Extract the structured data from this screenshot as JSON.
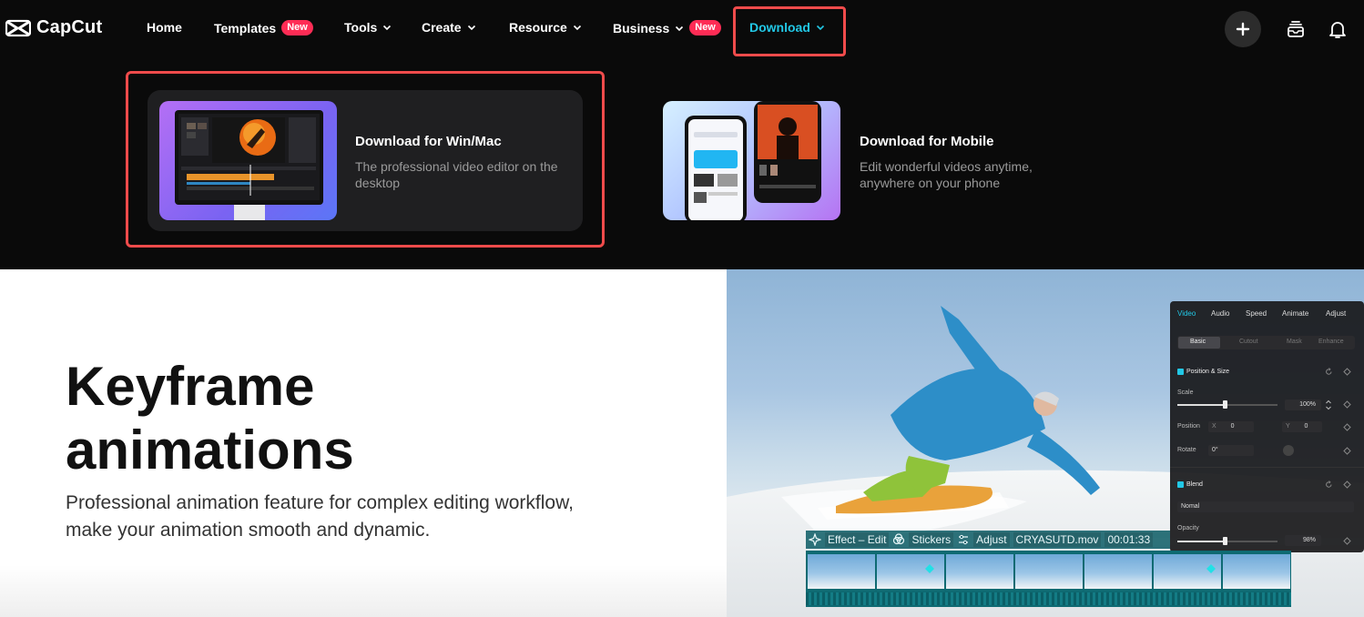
{
  "brand": {
    "name": "CapCut"
  },
  "nav": {
    "items": [
      {
        "label": "Home"
      },
      {
        "label": "Templates",
        "badge": "New"
      },
      {
        "label": "Tools"
      },
      {
        "label": "Create"
      },
      {
        "label": "Resource"
      },
      {
        "label": "Business",
        "badge": "New"
      },
      {
        "label": "Download",
        "active": true
      }
    ],
    "icons": [
      "plus-icon",
      "inbox-icon",
      "bell-icon"
    ],
    "accent_color": "#22c8e6",
    "badge_color": "#fe2c55",
    "highlight_color": "#f04b4b"
  },
  "dropdown": {
    "cards": [
      {
        "title": "Download for Win/Mac",
        "desc": "The professional video editor on the desktop"
      },
      {
        "title": "Download for Mobile",
        "desc": "Edit wonderful videos anytime, anywhere on your phone"
      }
    ]
  },
  "hero": {
    "title_line1": "Keyframe",
    "title_line2": "animations",
    "subtitle": "Professional animation feature for complex editing workflow, make your animation smooth and dynamic."
  },
  "editor_panel": {
    "tabs": [
      "Video",
      "Audio",
      "Speed",
      "Animate",
      "Adjust"
    ],
    "segments": [
      "Basic",
      "Cutout",
      "Mask",
      "Enhance"
    ],
    "position_size_label": "Position & Size",
    "scale_label": "Scale",
    "scale_value": "100%",
    "position_label": "Position",
    "pos_x_label": "X",
    "pos_x": "0",
    "pos_y_label": "Y",
    "pos_y": "0",
    "rotate_label": "Rotate",
    "rotate_value": "0°",
    "blend_label": "Blend",
    "blend_mode": "Nomal",
    "opacity_label": "Opacity",
    "opacity_value": "98%"
  },
  "timeline": {
    "tags": [
      "Effect – Edit",
      "Stickers",
      "Adjust",
      "CRYASUTD.mov",
      "00:01:33"
    ]
  }
}
